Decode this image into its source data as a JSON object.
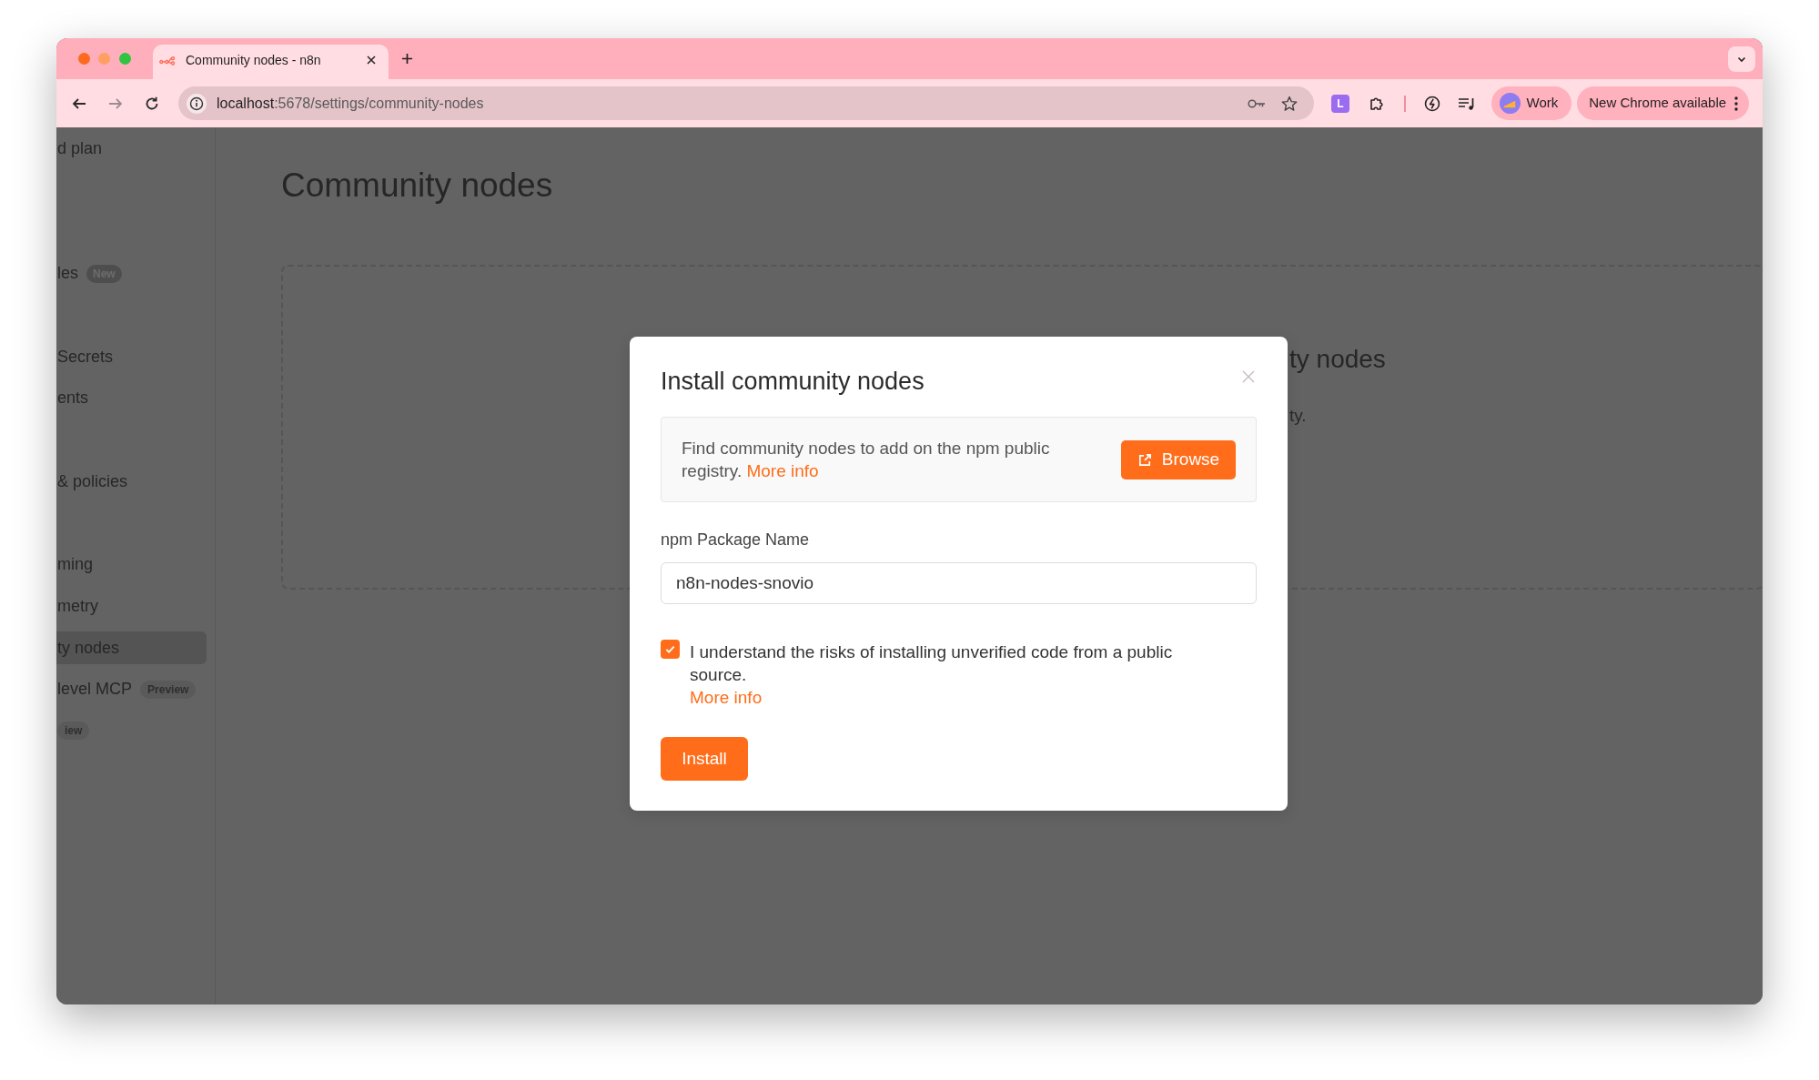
{
  "browser": {
    "tabs": [
      {
        "title": "Community nodes - n8n",
        "selected": true
      }
    ],
    "url": {
      "host": "localhost",
      "path": ":5678/settings/community-nodes"
    },
    "extension_label": "L",
    "profile": {
      "name": "Work"
    },
    "update_button": "New Chrome available"
  },
  "sidebar": {
    "items": [
      {
        "label": "d plan",
        "selected": false
      },
      {
        "label": "les",
        "badge": {
          "text": "New",
          "kind": "solid"
        },
        "selected": false
      },
      {
        "label": "Secrets",
        "selected": false
      },
      {
        "label": "ents",
        "selected": false
      },
      {
        "label": "& policies",
        "selected": false
      },
      {
        "label": "ming",
        "selected": false
      },
      {
        "label": "metry",
        "selected": false
      },
      {
        "label": "ty nodes",
        "selected": true
      },
      {
        "label": "level MCP",
        "badge": {
          "text": "Preview",
          "kind": "soft"
        },
        "selected": false
      },
      {
        "badge": {
          "text": "iew",
          "kind": "soft"
        },
        "selected": false
      }
    ]
  },
  "page": {
    "title": "Community nodes",
    "empty_state": {
      "title": "ty nodes",
      "text": "ty."
    }
  },
  "dialog": {
    "title": "Install community nodes",
    "info": {
      "text": "Find community nodes to add on the npm public registry.",
      "link": "More info",
      "button": "Browse"
    },
    "package_field": {
      "label": "npm Package Name",
      "value": "n8n-nodes-snovio"
    },
    "consent": {
      "checked": true,
      "text": "I understand the risks of installing unverified code from a public source.",
      "link": "More info"
    },
    "install_button": "Install"
  }
}
